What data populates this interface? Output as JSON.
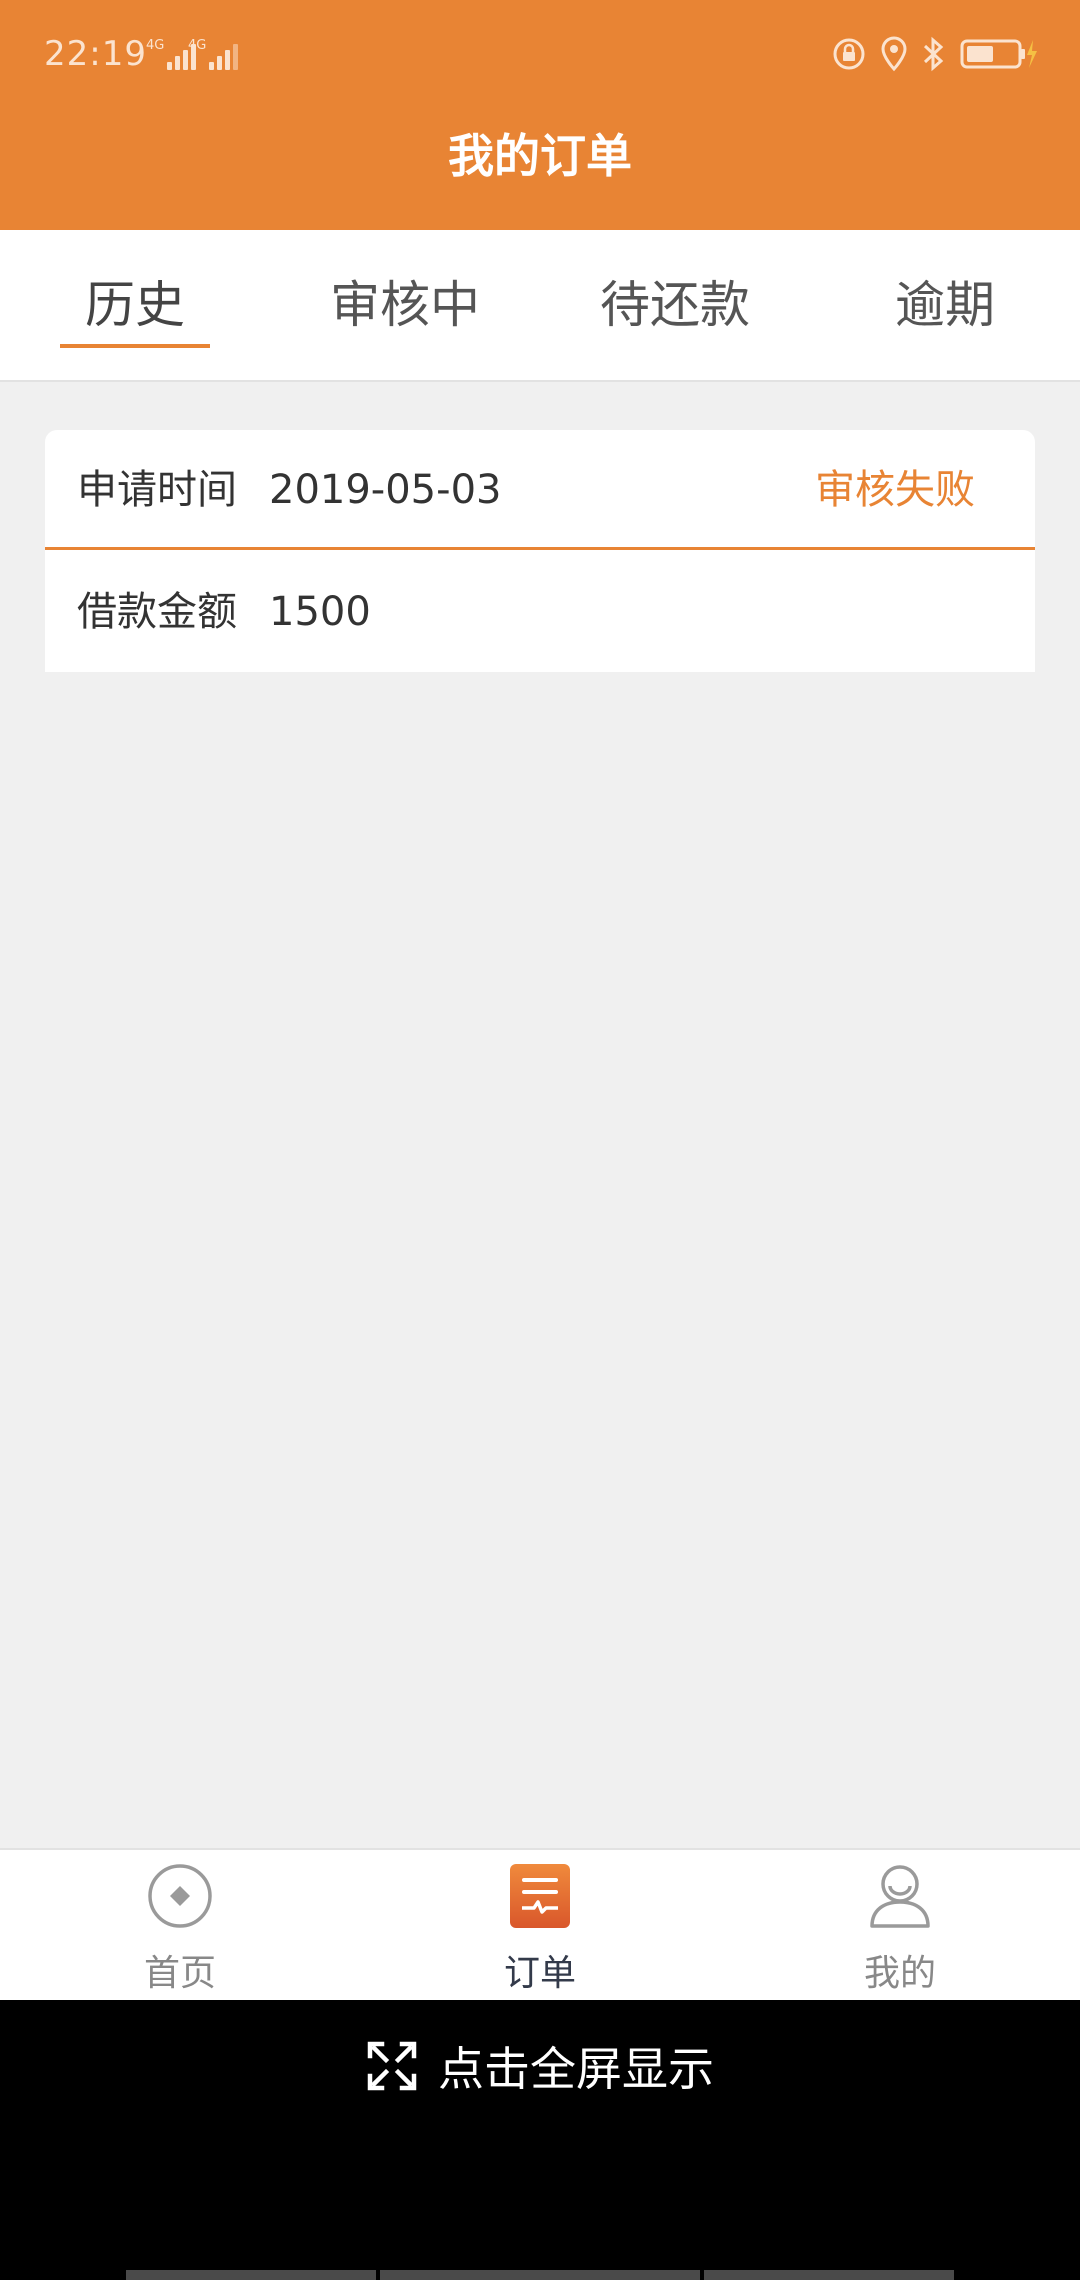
{
  "status_bar": {
    "time": "22:19",
    "network_1": "4G",
    "network_2": "4G"
  },
  "header": {
    "title": "我的订单"
  },
  "tabs": [
    {
      "label": "历史",
      "active": true
    },
    {
      "label": "审核中",
      "active": false
    },
    {
      "label": "待还款",
      "active": false
    },
    {
      "label": "逾期",
      "active": false
    }
  ],
  "order": {
    "apply_time_label": "申请时间",
    "apply_time_value": "2019-05-03",
    "status": "审核失败",
    "amount_label": "借款金额",
    "amount_value": "1500"
  },
  "bottom_nav": [
    {
      "label": "首页",
      "icon": "home-icon",
      "active": false
    },
    {
      "label": "订单",
      "icon": "order-icon",
      "active": true
    },
    {
      "label": "我的",
      "icon": "profile-icon",
      "active": false
    }
  ],
  "fullscreen": {
    "label": "点击全屏显示",
    "icon": "expand-icon"
  },
  "colors": {
    "accent": "#e88434",
    "background": "#f0f0f0",
    "nav_active": "#333a4a",
    "nav_inactive": "#888888"
  }
}
